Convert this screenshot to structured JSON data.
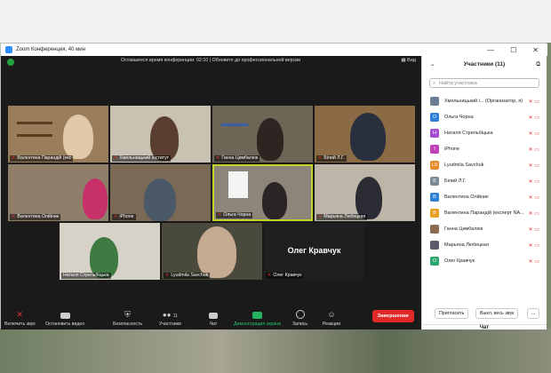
{
  "window": {
    "title": "Zoom Конференция, 40 мин",
    "controls": [
      "—",
      "☐",
      "✕"
    ]
  },
  "topbar": {
    "notice": "Оставшееся время конференции: 02:10 | Обновите до профессиональной версии",
    "view_label": "Вид"
  },
  "tiles": [
    {
      "name": "Валентина Парандій (екс"
    },
    {
      "name": "Хмельницький інститут"
    },
    {
      "name": "Ганна Цимбалюк"
    },
    {
      "name": "Білий Л.Г."
    },
    {
      "name": "Валентина Олійник"
    },
    {
      "name": "iPhone"
    },
    {
      "name": "Ольга Чорна"
    },
    {
      "name": "Марьяна Любецкая"
    },
    {
      "name": "Наталя Стрельбіцька"
    },
    {
      "name": "Lyudmila Savchuk"
    },
    {
      "name": "Олег Кравчук"
    }
  ],
  "big_name": "Олег Кравчук",
  "toolbar": {
    "mute": "Включить звук",
    "video": "Остановить видео",
    "security": "Безопасность",
    "participants": "Участники",
    "participants_count": "11",
    "chat": "Чат",
    "share": "Демонстрация экрана",
    "record": "Запись",
    "reactions": "Реакции",
    "end": "Завершение"
  },
  "panel": {
    "title": "Участники (11)",
    "search_placeholder": "Найти участника",
    "participants": [
      {
        "name": "Хмельницький і... (Организатор, я)",
        "initial": "",
        "color": "#6a7d93"
      },
      {
        "name": "Ольга Чорна",
        "initial": "О",
        "color": "#2d7fd8"
      },
      {
        "name": "Наталя Стрельбіцька",
        "initial": "Н",
        "color": "#a44dd0"
      },
      {
        "name": "iPhone",
        "initial": "I",
        "color": "#c040b8"
      },
      {
        "name": "Lyudmila Savchuk",
        "initial": "LS",
        "color": "#e88a2a"
      },
      {
        "name": "Білий Л.Г.",
        "initial": "Б",
        "color": "#7b8a96"
      },
      {
        "name": "Валентина Олійник",
        "initial": "В",
        "color": "#2d7fd8"
      },
      {
        "name": "Валентина Парандій (експерт NA...",
        "initial": "В",
        "color": "#e8a020"
      },
      {
        "name": "Ганна Цимбалюк",
        "initial": "",
        "color": "#8c6b4f"
      },
      {
        "name": "Марьяна Любецкая",
        "initial": "",
        "color": "#5b5b6b"
      },
      {
        "name": "Олег Кравчук",
        "initial": "О",
        "color": "#2aa56d"
      }
    ],
    "invite": "Пригласить",
    "mute_all": "Выкл. весь звук",
    "more": "...",
    "chat_title": "Чат"
  }
}
